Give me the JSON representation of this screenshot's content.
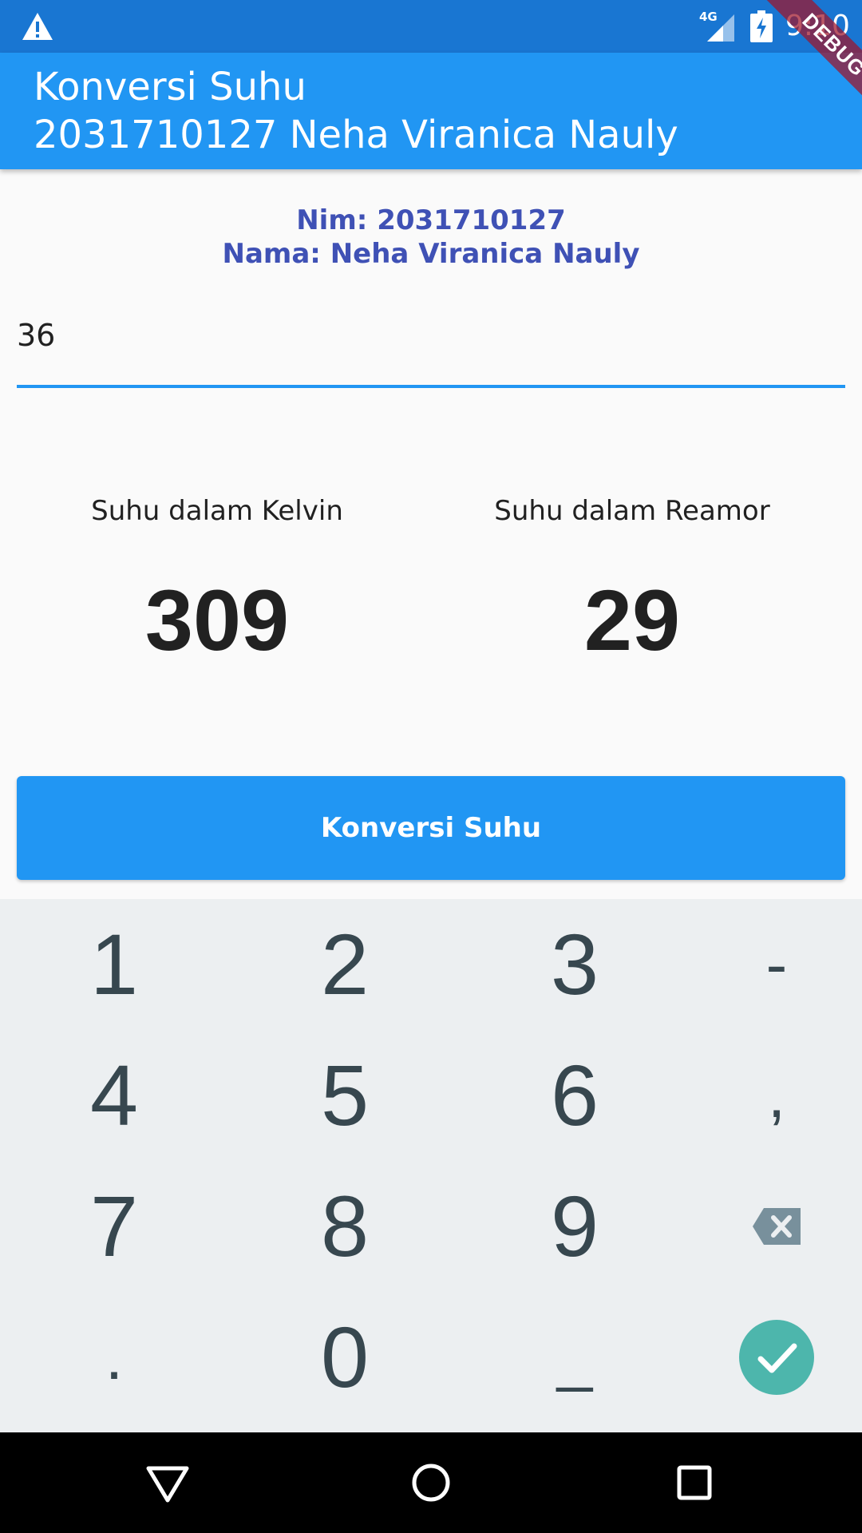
{
  "status_bar": {
    "network": "4G",
    "time": "9:10",
    "icons": [
      "warning-icon",
      "signal-icon",
      "battery-charging-icon"
    ]
  },
  "app_bar": {
    "title_line1": "Konversi Suhu",
    "title_line2": "2031710127 Neha Viranica Nauly",
    "debug_banner": "DEBUG"
  },
  "identity": {
    "nim": "Nim: 2031710127",
    "nama": "Nama: Neha Viranica Nauly"
  },
  "input": {
    "value": "36"
  },
  "results": {
    "kelvin_label": "Suhu dalam Kelvin",
    "kelvin_value": "309",
    "reamor_label": "Suhu dalam Reamor",
    "reamor_value": "29"
  },
  "button": {
    "label": "Konversi Suhu"
  },
  "keyboard": {
    "keys": [
      "1",
      "2",
      "3",
      "-",
      "4",
      "5",
      "6",
      ",",
      "7",
      "8",
      "9",
      "backspace",
      ".",
      "0",
      "_",
      "done"
    ]
  },
  "nav_bar": {
    "icons": [
      "back-icon",
      "home-icon",
      "recents-icon"
    ]
  },
  "colors": {
    "status_bar": "#1976d2",
    "app_bar": "#2196f3",
    "identity_text": "#3f51b5",
    "done_key": "#4db6ac",
    "keyboard_bg": "#eceff1"
  }
}
